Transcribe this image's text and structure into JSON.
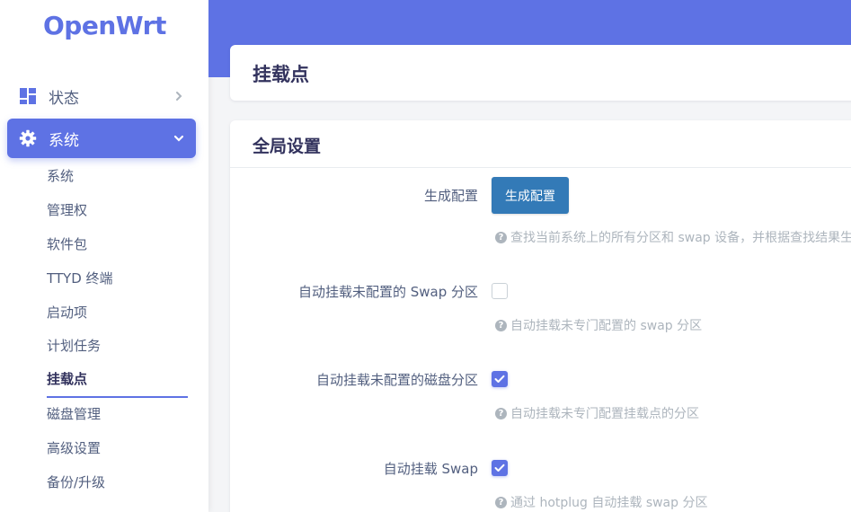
{
  "brand": {
    "logo": "OpenWrt",
    "accent": "#5e72e4"
  },
  "sidebar": {
    "top_items": [
      {
        "label": "状态",
        "icon": "dashboard-icon",
        "expanded": false
      },
      {
        "label": "系统",
        "icon": "gear-icon",
        "expanded": true
      }
    ],
    "sub_items": [
      {
        "label": "系统"
      },
      {
        "label": "管理权"
      },
      {
        "label": "软件包"
      },
      {
        "label": "TTYD 终端"
      },
      {
        "label": "启动项"
      },
      {
        "label": "计划任务"
      },
      {
        "label": "挂载点",
        "active": true
      },
      {
        "label": "磁盘管理"
      },
      {
        "label": "高级设置"
      },
      {
        "label": "备份/升级"
      }
    ]
  },
  "page": {
    "title": "挂载点"
  },
  "global": {
    "title": "全局设置",
    "generate": {
      "label": "生成配置",
      "button": "生成配置",
      "hint": "查找当前系统上的所有分区和 swap 设备，并根据查找结果生成"
    },
    "auto_swap_unconfigured": {
      "label": "自动挂载未配置的 Swap 分区",
      "checked": false,
      "hint": "自动挂载未专门配置的 swap 分区"
    },
    "auto_mount_unconfigured": {
      "label": "自动挂载未配置的磁盘分区",
      "checked": true,
      "hint": "自动挂载未专门配置挂载点的分区"
    },
    "auto_swap": {
      "label": "自动挂载 Swap",
      "checked": true,
      "hint": "通过 hotplug 自动挂载 swap 分区"
    }
  }
}
